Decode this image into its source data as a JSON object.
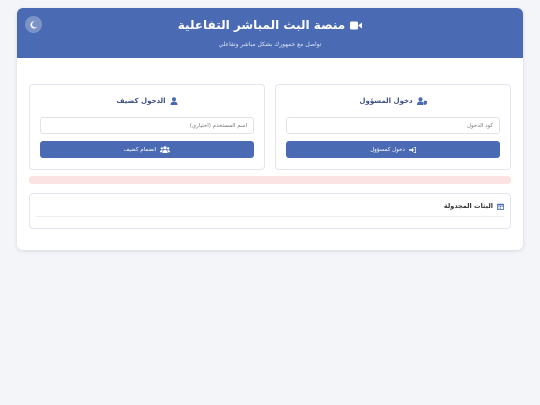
{
  "header": {
    "title": "منصة البث المباشر التفاعلية",
    "subtitle": "تواصل مع جمهورك بشكل مباشر وتفاعلي",
    "title_icon": "video-camera-icon",
    "theme_icon": "moon-icon"
  },
  "admin_panel": {
    "title": "دخول المسؤول",
    "icon": "user-shield-icon",
    "input_placeholder": "كود الدخول",
    "button_label": "دخول كمسؤول",
    "button_icon": "sign-in-icon"
  },
  "guest_panel": {
    "title": "الدخول كضيف",
    "icon": "user-icon",
    "input_placeholder": "اسم المستخدم (اختياري)",
    "button_label": "انضمام كضيف",
    "button_icon": "users-icon"
  },
  "scheduled": {
    "title": "البثات المجدولة",
    "icon": "calendar-icon"
  },
  "colors": {
    "primary": "#4a6ab3",
    "background": "#f4f5f9",
    "error_bar": "#fbe3e3"
  }
}
